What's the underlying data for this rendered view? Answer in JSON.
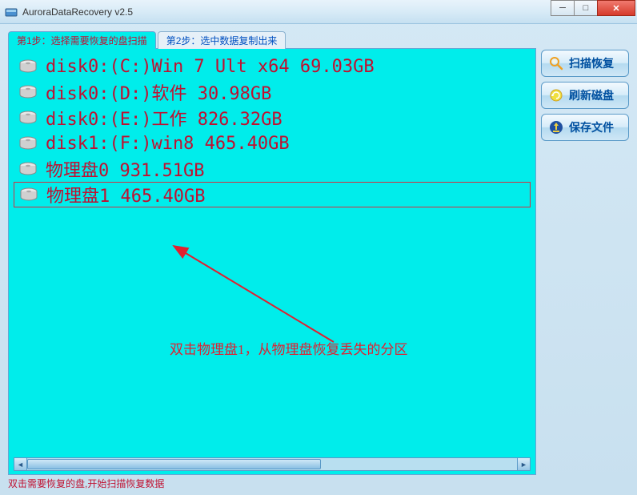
{
  "window": {
    "title": "AuroraDataRecovery v2.5"
  },
  "tabs": {
    "step1": "第1步：选择需要恢复的盘扫描",
    "step2": "第2步：选中数据复制出来"
  },
  "disks": [
    {
      "label": "disk0:(C:)Win 7 Ult x64 69.03GB",
      "selected": false
    },
    {
      "label": "disk0:(D:)软件 30.98GB",
      "selected": false
    },
    {
      "label": "disk0:(E:)工作 826.32GB",
      "selected": false
    },
    {
      "label": "disk1:(F:)win8 465.40GB",
      "selected": false
    },
    {
      "label": "物理盘0 931.51GB",
      "selected": false
    },
    {
      "label": "物理盘1 465.40GB",
      "selected": true
    }
  ],
  "annotation": "双击物理盘1，从物理盘恢复丢失的分区",
  "buttons": {
    "scan": "扫描恢复",
    "refresh": "刷新磁盘",
    "save": "保存文件"
  },
  "statusbar": "双击需要恢复的盘,开始扫描恢复数据"
}
